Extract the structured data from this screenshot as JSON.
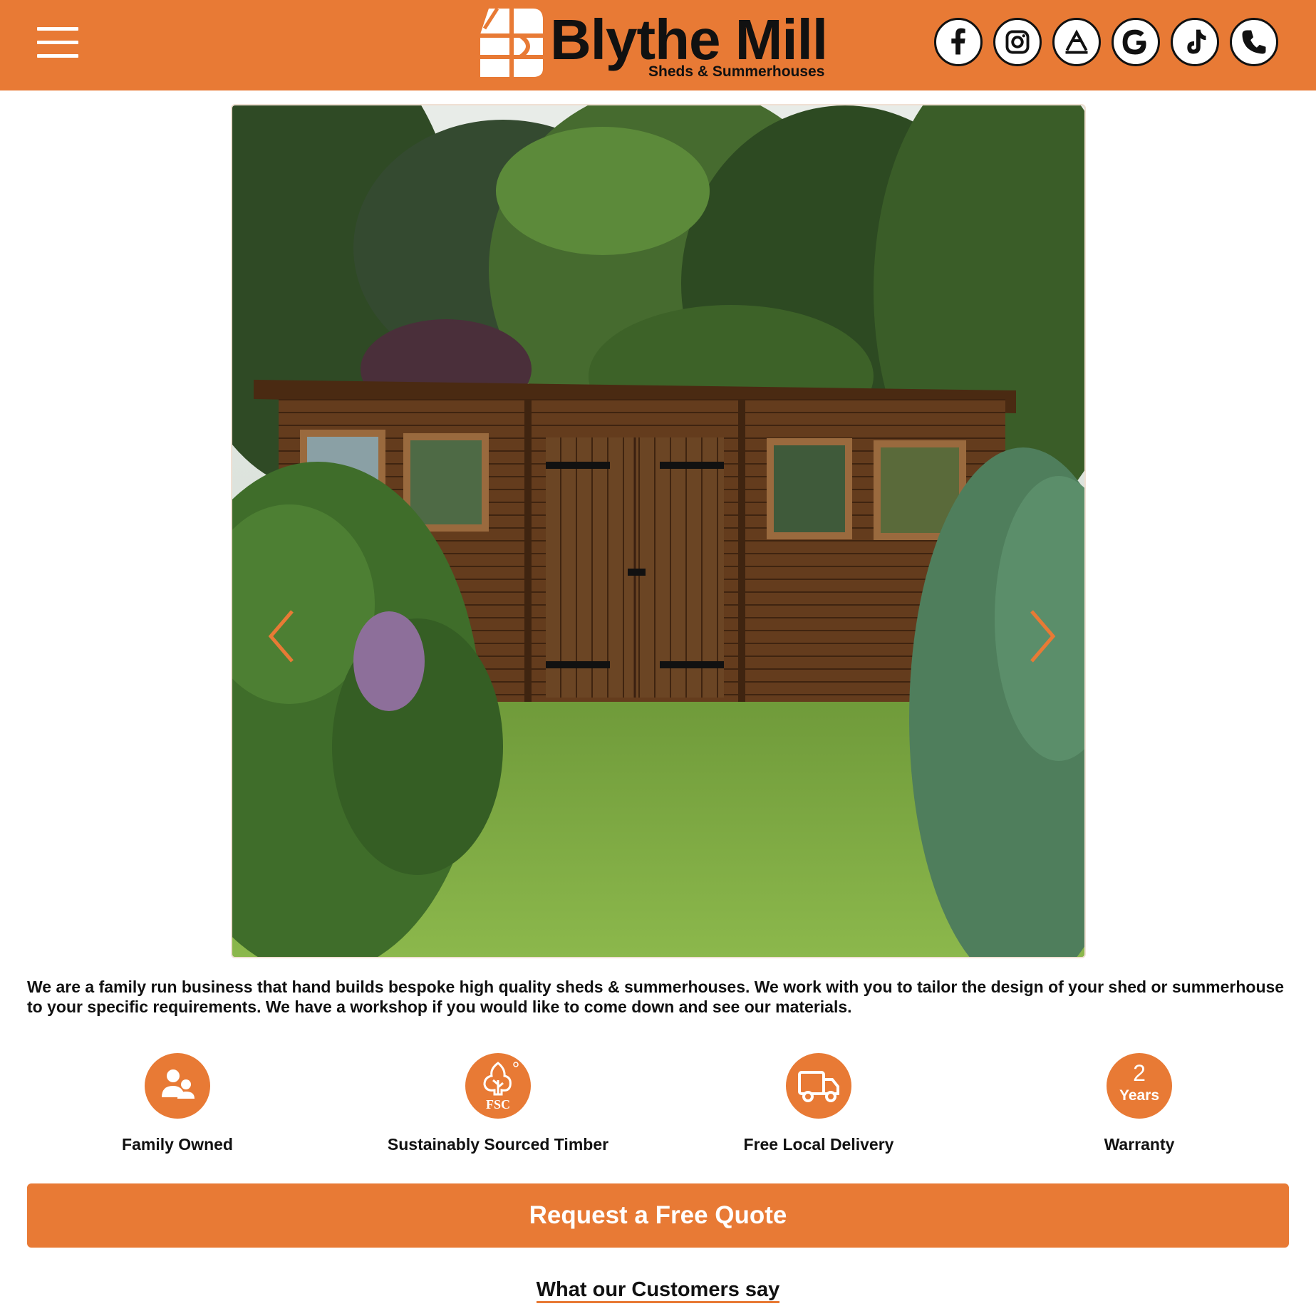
{
  "brand": {
    "name": "Blythe Mill",
    "tagline": "Sheds & Summerhouses",
    "accent_color": "#e87a35"
  },
  "header": {
    "menu_icon": "hamburger-menu-icon",
    "social": [
      {
        "name": "facebook",
        "icon": "facebook-icon",
        "glyph": "f"
      },
      {
        "name": "instagram",
        "icon": "instagram-icon"
      },
      {
        "name": "checkatrade",
        "icon": "checkatrade-icon"
      },
      {
        "name": "google",
        "icon": "google-icon",
        "glyph": "G"
      },
      {
        "name": "tiktok",
        "icon": "tiktok-icon"
      },
      {
        "name": "phone",
        "icon": "phone-icon"
      }
    ]
  },
  "hero": {
    "image": "garden-shed-photo",
    "prev_icon": "chevron-left-icon",
    "next_icon": "chevron-right-icon"
  },
  "intro": {
    "text": "We are a family run business that hand builds bespoke high quality sheds & summerhouses. We work with you to tailor the design of your shed or summerhouse to your specific requirements. We have a workshop if you would like to come down and see our materials."
  },
  "features": [
    {
      "label": "Family Owned",
      "icon": "family-icon"
    },
    {
      "label": "Sustainably Sourced Timber",
      "icon": "fsc-tree-icon",
      "badge_text": "FSC"
    },
    {
      "label": "Free Local Delivery",
      "icon": "delivery-truck-icon"
    },
    {
      "label": "Warranty",
      "icon": "warranty-badge",
      "number": "2",
      "unit": "Years"
    }
  ],
  "cta": {
    "label": "Request a Free Quote"
  },
  "reviews": {
    "heading": "What our Customers say"
  }
}
